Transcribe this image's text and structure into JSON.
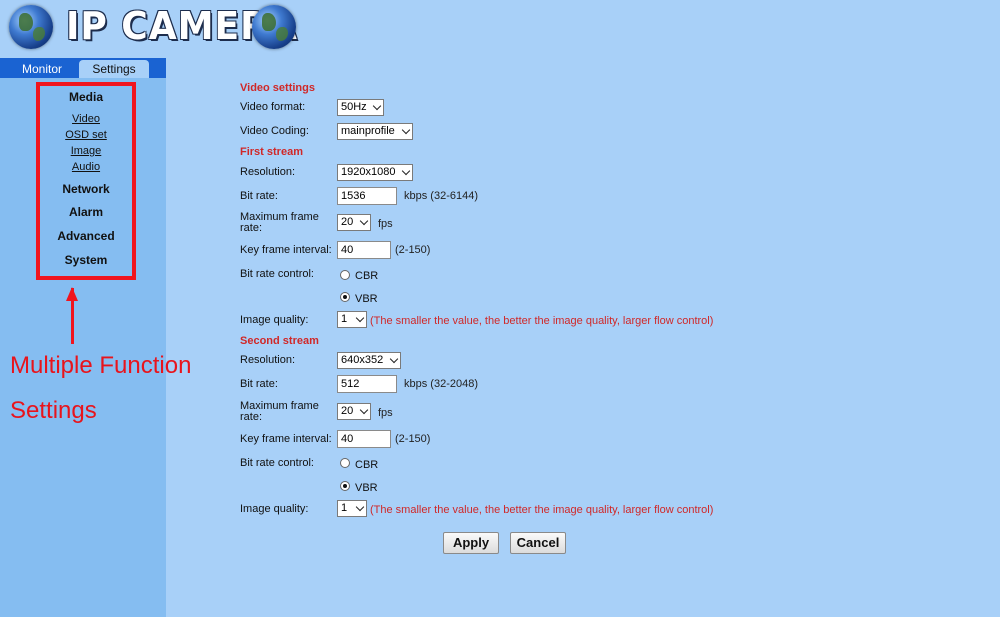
{
  "brand": {
    "title": "IP CAMERA"
  },
  "tabs": {
    "monitor": "Monitor",
    "settings": "Settings"
  },
  "sidebar": {
    "media": "Media",
    "video": "Video",
    "osd": "OSD set",
    "image": "Image",
    "audio": "Audio",
    "network": "Network",
    "alarm": "Alarm",
    "advanced": "Advanced",
    "system": "System"
  },
  "annotation": {
    "line1": "Multiple Function",
    "line2": "Settings"
  },
  "colors": {
    "accent_red": "#f0141e",
    "tab_blue": "#1a63d2",
    "page_bg": "#a8d0f8",
    "sidebar_bg": "#85bdf1",
    "section_red": "#d02828"
  },
  "video_settings": {
    "title": "Video settings",
    "format_label": "Video format:",
    "format_value": "50Hz",
    "coding_label": "Video Coding:",
    "coding_value": "mainprofile"
  },
  "first_stream": {
    "title": "First stream",
    "resolution_label": "Resolution:",
    "resolution_value": "1920x1080",
    "bitrate_label": "Bit rate:",
    "bitrate_value": "1536",
    "bitrate_hint": "kbps (32-6144)",
    "framerate_label_1": "Maximum frame",
    "framerate_label_2": "rate:",
    "framerate_value": "20",
    "framerate_unit": "fps",
    "keyframe_label": "Key frame interval:",
    "keyframe_value": "40",
    "keyframe_hint": "(2-150)",
    "brc_label": "Bit rate control:",
    "cbr": "CBR",
    "vbr": "VBR",
    "brc_selected": "VBR",
    "quality_label": "Image quality:",
    "quality_value": "1",
    "quality_hint": "(The smaller the value, the better the image quality, larger flow control)"
  },
  "second_stream": {
    "title": "Second stream",
    "resolution_label": "Resolution:",
    "resolution_value": "640x352",
    "bitrate_label": "Bit rate:",
    "bitrate_value": "512",
    "bitrate_hint": "kbps (32-2048)",
    "framerate_label_1": "Maximum frame",
    "framerate_label_2": "rate:",
    "framerate_value": "20",
    "framerate_unit": "fps",
    "keyframe_label": "Key frame interval:",
    "keyframe_value": "40",
    "keyframe_hint": "(2-150)",
    "brc_label": "Bit rate control:",
    "cbr": "CBR",
    "vbr": "VBR",
    "brc_selected": "VBR",
    "quality_label": "Image quality:",
    "quality_value": "1",
    "quality_hint": "(The smaller the value, the better the image quality, larger flow control)"
  },
  "buttons": {
    "apply": "Apply",
    "cancel": "Cancel"
  }
}
